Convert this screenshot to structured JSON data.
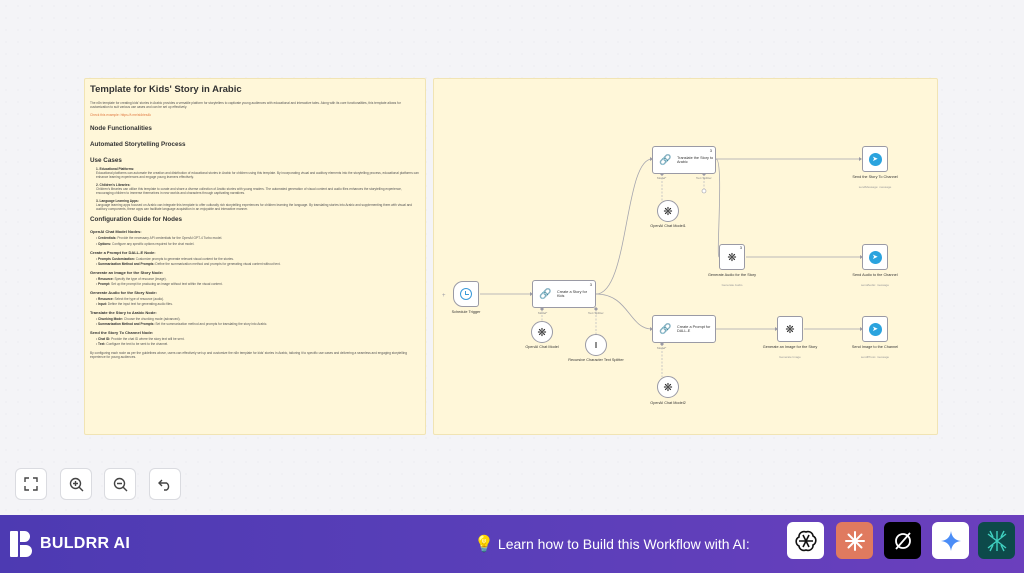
{
  "note_left": {
    "title": "Template for Kids' Story in Arabic",
    "intro": "The n8n template for creating kids' stories in Arabic provides a versatile platform for storytellers to captivate young audiences with educational and interactive tales. Along with its core functionalities, this template allows for customization to suit various use cases and can be set up effectively.",
    "check_example_label": "Check this example:",
    "check_example_link": "https://t.me/st4ries4k",
    "h_node_func": "Node Functionalities",
    "h_auto": "Automated Storytelling Process",
    "h_use_cases": "Use Cases",
    "use_cases": [
      {
        "title": "1. Educational Platforms:",
        "text": "Educational platforms can automate the creation and distribution of educational stories in Arabic for children using this template. By incorporating visual and auditory elements into the storytelling process, educational platforms can enhance learning experiences and engage young learners effectively."
      },
      {
        "title": "2. Children's Libraries:",
        "text": "Children's libraries can utilize this template to curate and share a diverse collection of Arabic stories with young readers. The automated generation of visual content and audio files enhances the storytelling experience, encouraging children to immerse themselves in new worlds and characters through captivating narratives."
      },
      {
        "title": "3. Language Learning Apps:",
        "text": "Language learning apps focused on Arabic can integrate this template to offer culturally rich storytelling experiences for children learning the language. By translating stories into Arabic and supplementing them with visual and auditory components, these apps can facilitate language acquisition in an enjoyable and interactive manner."
      }
    ],
    "h_config": "Configuration Guide for Nodes",
    "config": [
      {
        "heading": "OpenAI Chat Model Nodes:",
        "items": [
          {
            "k": "Credentials:",
            "v": "Provide the necessary API credentials for the OpenAI GPT-4 Turbo model."
          },
          {
            "k": "Options:",
            "v": "Configure any specific options required for the chat model."
          }
        ]
      },
      {
        "heading": "Create a Prompt for DALL-E Node:",
        "items": [
          {
            "k": "Prompts Customization:",
            "v": "Customize prompts to generate relevant visual content for the stories."
          },
          {
            "k": "Summarization Method and Prompts:",
            "v": "Define the summarization method and prompts for generating visual content without text."
          }
        ]
      },
      {
        "heading": "Generate an Image for the Story Node:",
        "items": [
          {
            "k": "Resource:",
            "v": "Specify the type of resource (image)."
          },
          {
            "k": "Prompt:",
            "v": "Set up the prompt for producing an image without text within the visual content."
          }
        ]
      },
      {
        "heading": "Generate Audio for the Story Node:",
        "items": [
          {
            "k": "Resource:",
            "v": "Select the type of resource (audio)."
          },
          {
            "k": "Input:",
            "v": "Define the input text for generating audio files."
          }
        ]
      },
      {
        "heading": "Translate the Story to Arabic Node:",
        "items": [
          {
            "k": "Chunking Mode:",
            "v": "Choose the chunking mode (advanced)."
          },
          {
            "k": "Summarization Method and Prompts:",
            "v": "Set the summarization method and prompts for translating the story into Arabic."
          }
        ]
      },
      {
        "heading": "Send the Story To Channel Node:",
        "items": [
          {
            "k": "Chat ID:",
            "v": "Provide the chat ID where the story text will be sent."
          },
          {
            "k": "Text:",
            "v": "Configure the text to be sent to the channel."
          }
        ]
      }
    ],
    "closing": "By configuring each node as per the guidelines above, users can effectively set up and customize the n8n template for kids' stories in Arabic, tailoring it to specific use cases and delivering a seamless and engaging storytelling experience for young audiences."
  },
  "flow": {
    "schedule_trigger": "Schedule Trigger",
    "create_story": "Create a Story for Kids",
    "translate": "Translate the Story to Arabic",
    "create_prompt": "Create a Prompt for DALL-E",
    "openai_model_1": "OpenAI Chat Model",
    "openai_model_2": "OpenAI Chat Model1",
    "openai_model_3": "OpenAI Chat Model2",
    "recursive_splitter": "Recursive Character Text Splitter",
    "gen_audio": "Generate Audio for the Story",
    "gen_audio_sub": "Generate Audio",
    "gen_image": "Generate an Image for the Story",
    "gen_image_sub": "Generate Image",
    "send_story": "Send the Story To Channel",
    "send_story_sub": "sendMessage: message",
    "send_audio": "Send Audio to the Channel",
    "send_audio_sub": "sendAudio: message",
    "send_image": "Send Image to the Channel",
    "send_image_sub": "sendPhoto: message",
    "port_model": "Model*",
    "port_splitter": "Text Splitter",
    "badge": "3"
  },
  "controls": {
    "fit_icon": "fit-view-icon",
    "zoom_in_icon": "zoom-in-icon",
    "zoom_out_icon": "zoom-out-icon",
    "undo_icon": "undo-icon"
  },
  "footer": {
    "brand": "BULDRR AI",
    "cta": "Learn how to Build this Workflow with AI:",
    "ai_tools": [
      "chatgpt-icon",
      "claude-icon",
      "perplexity-icon",
      "gemini-icon",
      "deepseek-icon"
    ]
  },
  "colors": {
    "note_bg": "#fff7d9",
    "footer_bg": "#5a3fb9",
    "telegram": "#2aa3de",
    "link": "#e0773d"
  }
}
